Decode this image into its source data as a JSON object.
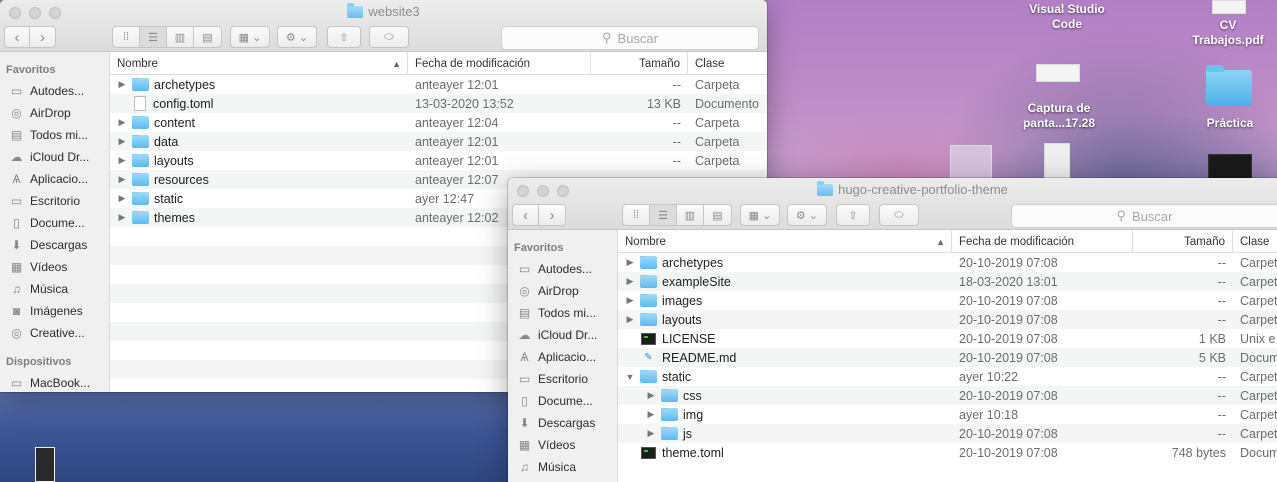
{
  "desktop": {
    "icons": [
      {
        "label": "Visual Studio Code"
      },
      {
        "label": "CV Trabajos.pdf"
      },
      {
        "label": "Captura de panta...17.28"
      },
      {
        "label": "Práctica"
      }
    ]
  },
  "search_placeholder": "Buscar",
  "columns": {
    "name": "Nombre",
    "date": "Fecha de modificación",
    "size": "Tamaño",
    "kind": "Clase"
  },
  "sidebar": {
    "favorites_header": "Favoritos",
    "devices_header": "Dispositivos",
    "items": [
      {
        "label": "Autodes...",
        "icon": "folder-icon"
      },
      {
        "label": "AirDrop",
        "icon": "airdrop-icon"
      },
      {
        "label": "Todos mi...",
        "icon": "all-files-icon"
      },
      {
        "label": "iCloud Dr...",
        "icon": "cloud-icon"
      },
      {
        "label": "Aplicacio...",
        "icon": "applications-icon"
      },
      {
        "label": "Escritorio",
        "icon": "desktop-icon"
      },
      {
        "label": "Docume...",
        "icon": "documents-icon"
      },
      {
        "label": "Descargas",
        "icon": "download-icon"
      },
      {
        "label": "Vídeos",
        "icon": "film-icon"
      },
      {
        "label": "Música",
        "icon": "music-icon"
      },
      {
        "label": "Imágenes",
        "icon": "camera-icon"
      },
      {
        "label": "Creative...",
        "icon": "creative-cloud-icon"
      }
    ],
    "devices": [
      {
        "label": "MacBook...",
        "icon": "laptop-icon"
      }
    ]
  },
  "window1": {
    "title": "website3",
    "rows": [
      {
        "name": "archetypes",
        "date": "anteayer 12:01",
        "size": "--",
        "kind": "Carpeta",
        "type": "folder"
      },
      {
        "name": "config.toml",
        "date": "13-03-2020 13:52",
        "size": "13 KB",
        "kind": "Documento",
        "type": "doc"
      },
      {
        "name": "content",
        "date": "anteayer 12:04",
        "size": "--",
        "kind": "Carpeta",
        "type": "folder"
      },
      {
        "name": "data",
        "date": "anteayer 12:01",
        "size": "--",
        "kind": "Carpeta",
        "type": "folder"
      },
      {
        "name": "layouts",
        "date": "anteayer 12:01",
        "size": "--",
        "kind": "Carpeta",
        "type": "folder"
      },
      {
        "name": "resources",
        "date": "anteayer 12:07",
        "size": "",
        "kind": "",
        "type": "folder"
      },
      {
        "name": "static",
        "date": "ayer 12:47",
        "size": "",
        "kind": "",
        "type": "folder"
      },
      {
        "name": "themes",
        "date": "anteayer 12:02",
        "size": "",
        "kind": "",
        "type": "folder"
      }
    ]
  },
  "window2": {
    "title": "hugo-creative-portfolio-theme",
    "rows": [
      {
        "name": "archetypes",
        "date": "20-10-2019 07:08",
        "size": "--",
        "kind": "Carpet",
        "type": "folder",
        "depth": 0,
        "tri": "▶"
      },
      {
        "name": "exampleSite",
        "date": "18-03-2020 13:01",
        "size": "--",
        "kind": "Carpet",
        "type": "folder",
        "depth": 0,
        "tri": "▶"
      },
      {
        "name": "images",
        "date": "20-10-2019 07:08",
        "size": "--",
        "kind": "Carpet",
        "type": "folder",
        "depth": 0,
        "tri": "▶"
      },
      {
        "name": "layouts",
        "date": "20-10-2019 07:08",
        "size": "--",
        "kind": "Carpet",
        "type": "folder",
        "depth": 0,
        "tri": "▶"
      },
      {
        "name": "LICENSE",
        "date": "20-10-2019 07:08",
        "size": "1 KB",
        "kind": "Unix e",
        "type": "term",
        "depth": 0,
        "tri": ""
      },
      {
        "name": "README.md",
        "date": "20-10-2019 07:08",
        "size": "5 KB",
        "kind": "Docum",
        "type": "md",
        "depth": 0,
        "tri": ""
      },
      {
        "name": "static",
        "date": "ayer 10:22",
        "size": "--",
        "kind": "Carpet",
        "type": "folder",
        "depth": 0,
        "tri": "▼"
      },
      {
        "name": "css",
        "date": "20-10-2019 07:08",
        "size": "--",
        "kind": "Carpet",
        "type": "folder",
        "depth": 1,
        "tri": "▶"
      },
      {
        "name": "img",
        "date": "ayer 10:18",
        "size": "--",
        "kind": "Carpet",
        "type": "folder",
        "depth": 1,
        "tri": "▶"
      },
      {
        "name": "js",
        "date": "20-10-2019 07:08",
        "size": "--",
        "kind": "Carpet",
        "type": "folder",
        "depth": 1,
        "tri": "▶"
      },
      {
        "name": "theme.toml",
        "date": "20-10-2019 07:08",
        "size": "748 bytes",
        "kind": "Docum",
        "type": "term",
        "depth": 0,
        "tri": ""
      }
    ]
  }
}
